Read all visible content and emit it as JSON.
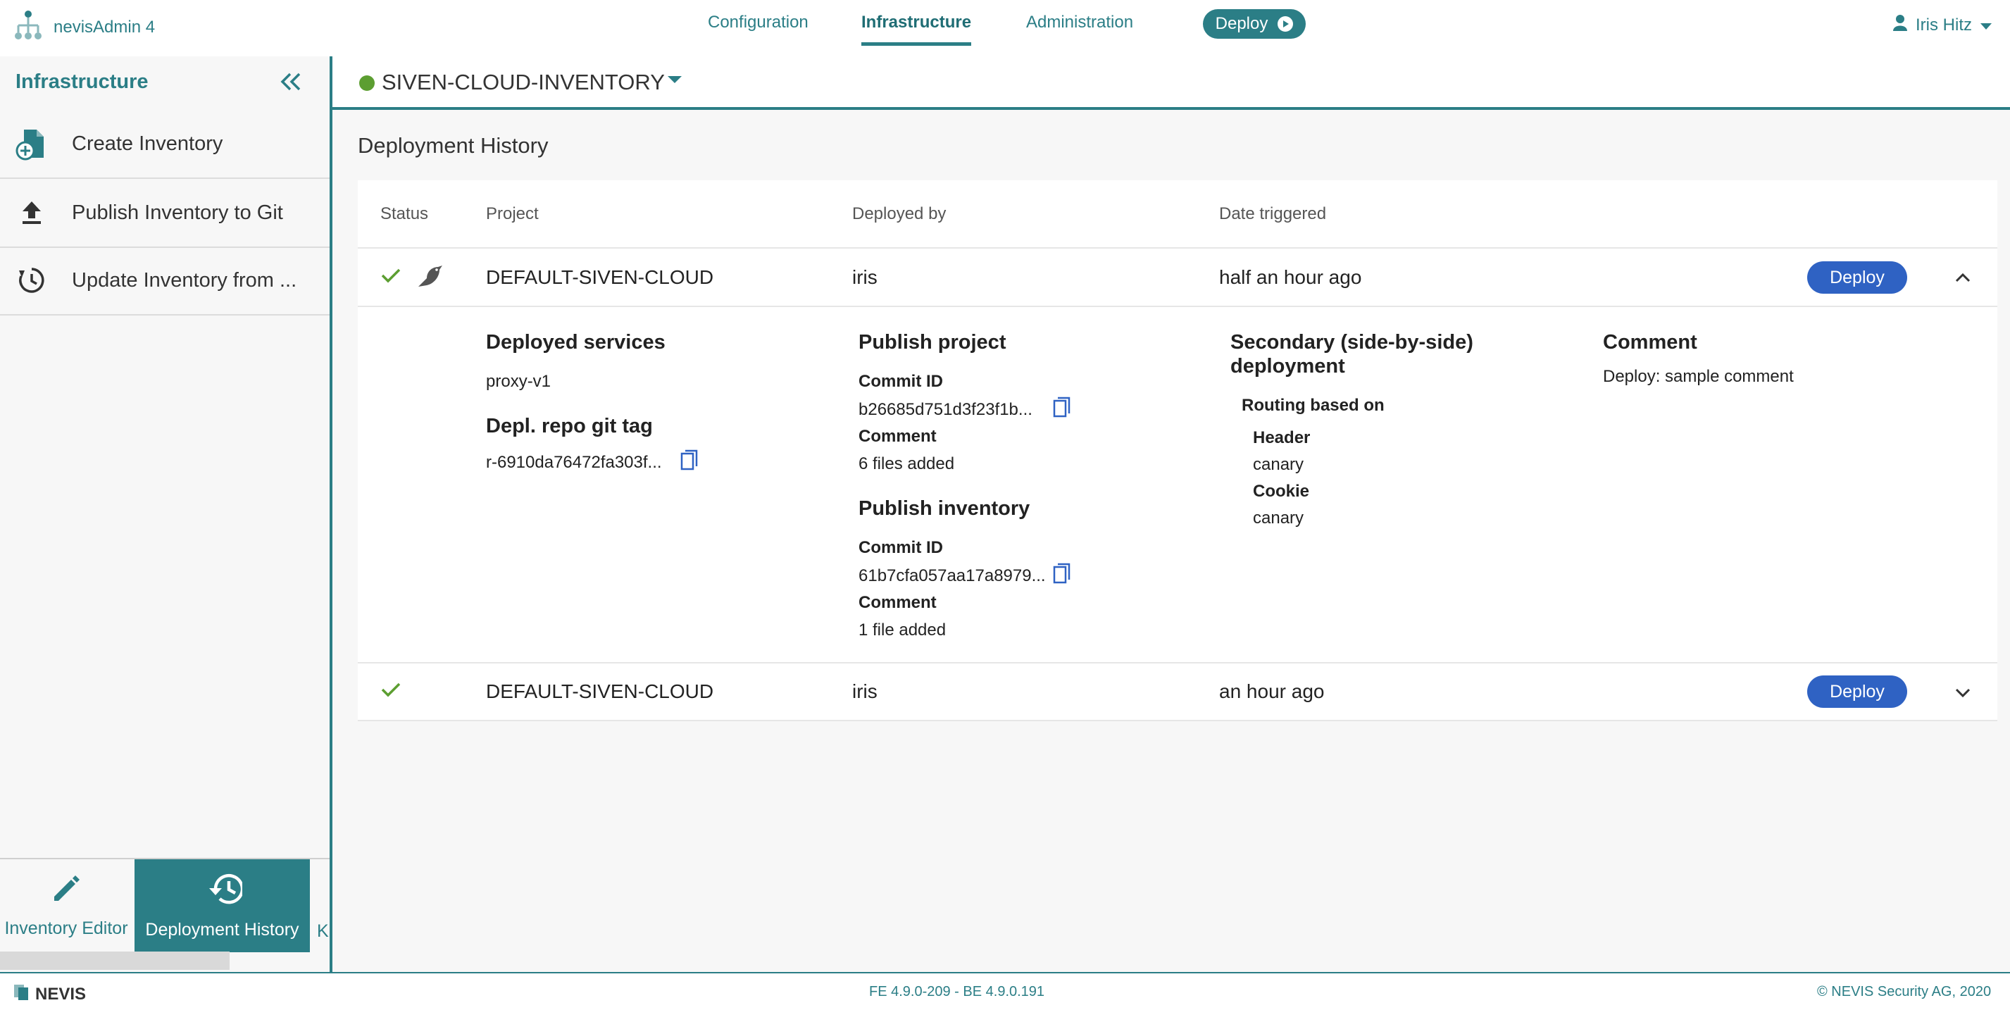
{
  "app": {
    "name": "nevisAdmin 4"
  },
  "nav": {
    "configuration": "Configuration",
    "infrastructure": "Infrastructure",
    "administration": "Administration",
    "deploy": "Deploy"
  },
  "user": {
    "name": "Iris Hitz"
  },
  "sidebar": {
    "title": "Infrastructure",
    "items": [
      {
        "label": "Create Inventory",
        "icon": "create-inventory-icon"
      },
      {
        "label": "Publish Inventory to Git",
        "icon": "upload-icon"
      },
      {
        "label": "Update Inventory from ...",
        "icon": "refresh-history-icon"
      }
    ],
    "bottom_tabs": [
      {
        "label": "Inventory Editor",
        "icon": "pencil-icon"
      },
      {
        "label": "Deployment History",
        "icon": "history-icon"
      }
    ],
    "truncated_tab": "K"
  },
  "inventory": {
    "name": "SIVEN-CLOUD-INVENTORY",
    "status_color": "#5c9e31"
  },
  "page": {
    "title": "Deployment History"
  },
  "table": {
    "headers": {
      "status": "Status",
      "project": "Project",
      "deployed_by": "Deployed by",
      "date": "Date triggered"
    },
    "rows": [
      {
        "project": "DEFAULT-SIVEN-CLOUD",
        "deployed_by": "iris",
        "date": "half an hour ago",
        "action": "Deploy",
        "status": "success",
        "canary": true,
        "expanded": true
      },
      {
        "project": "DEFAULT-SIVEN-CLOUD",
        "deployed_by": "iris",
        "date": "an hour ago",
        "action": "Deploy",
        "status": "success",
        "canary": false,
        "expanded": false
      }
    ]
  },
  "details": {
    "deployed_services": {
      "title": "Deployed services",
      "value": "proxy-v1"
    },
    "git_tag": {
      "title": "Depl. repo git tag",
      "value": "r-6910da76472fa303f..."
    },
    "publish_project": {
      "title": "Publish project",
      "commit_label": "Commit ID",
      "commit": "b26685d751d3f23f1b...",
      "comment_label": "Comment",
      "comment": "6 files added"
    },
    "publish_inventory": {
      "title": "Publish inventory",
      "commit_label": "Commit ID",
      "commit": "61b7cfa057aa17a8979...",
      "comment_label": "Comment",
      "comment": "1 file added"
    },
    "secondary": {
      "title_line1": "Secondary (side-by-side)",
      "title_line2": "deployment",
      "routing_label": "Routing based on",
      "header_label": "Header",
      "header_value": "canary",
      "cookie_label": "Cookie",
      "cookie_value": "canary"
    },
    "comment": {
      "title": "Comment",
      "value": "Deploy: sample comment"
    }
  },
  "footer": {
    "brand": "NEVIS",
    "version": "FE 4.9.0-209 - BE 4.9.0.191",
    "copyright": "© NEVIS Security AG, 2020"
  },
  "colors": {
    "teal": "#2b7e86",
    "deploy_blue": "#2f62c3",
    "success_green": "#5c9e31"
  }
}
